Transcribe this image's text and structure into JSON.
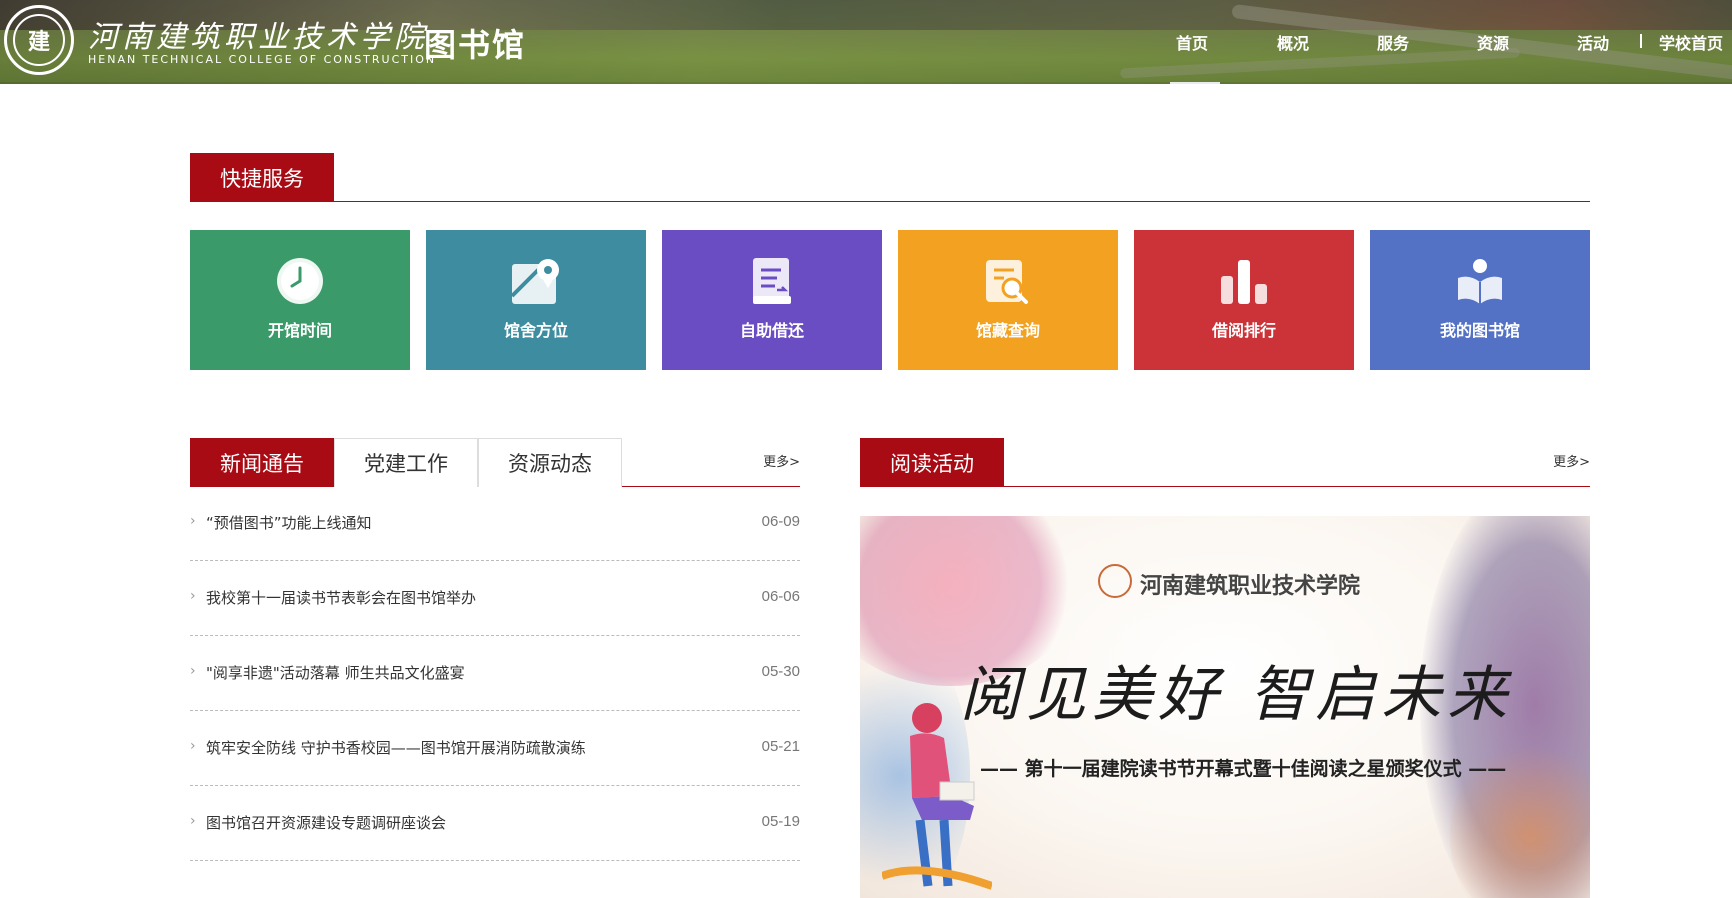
{
  "header": {
    "seal_text": "建",
    "college_name_cn": "河南建筑职业技术学院",
    "college_name_en": "HENAN TECHNICAL COLLEGE OF CONSTRUCTION",
    "site_title": "图书馆",
    "nav": [
      {
        "label": "首页",
        "active": true
      },
      {
        "label": "概况",
        "active": false
      },
      {
        "label": "服务",
        "active": false
      },
      {
        "label": "资源",
        "active": false
      },
      {
        "label": "活动",
        "active": false
      },
      {
        "label": "学校首页",
        "active": false
      }
    ]
  },
  "quick_services": {
    "title": "快捷服务",
    "tiles": [
      {
        "label": "开馆时间",
        "color": "#3a9a69",
        "icon": "clock-icon"
      },
      {
        "label": "馆舍方位",
        "color": "#3d8c9f",
        "icon": "map-pin-icon"
      },
      {
        "label": "自助借还",
        "color": "#6a4cc3",
        "icon": "book-return-icon"
      },
      {
        "label": "馆藏查询",
        "color": "#f2a121",
        "icon": "search-doc-icon"
      },
      {
        "label": "借阅排行",
        "color": "#cc3338",
        "icon": "bar-chart-icon"
      },
      {
        "label": "我的图书馆",
        "color": "#5372c6",
        "icon": "reader-icon"
      }
    ]
  },
  "news": {
    "tabs": [
      "新闻通告",
      "党建工作",
      "资源动态"
    ],
    "more": "更多>",
    "items": [
      {
        "title": "“预借图书”功能上线通知",
        "date": "06-09"
      },
      {
        "title": "我校第十一届读书节表彰会在图书馆举办",
        "date": "06-06"
      },
      {
        "title": "\"阅享非遗\"活动落幕 师生共品文化盛宴",
        "date": "05-30"
      },
      {
        "title": "筑牢安全防线 守护书香校园——图书馆开展消防疏散演练",
        "date": "05-21"
      },
      {
        "title": "图书馆召开资源建设专题调研座谈会",
        "date": "05-19"
      }
    ]
  },
  "reading": {
    "title": "阅读活动",
    "more": "更多>",
    "poster": {
      "college": "河南建筑职业技术学院",
      "slogan": "阅见美好 智启未来",
      "subtitle": "—— 第十一届建院读书节开幕式暨十佳阅读之星颁奖仪式 ——"
    }
  },
  "colors": {
    "brand_red": "#a80b14"
  }
}
